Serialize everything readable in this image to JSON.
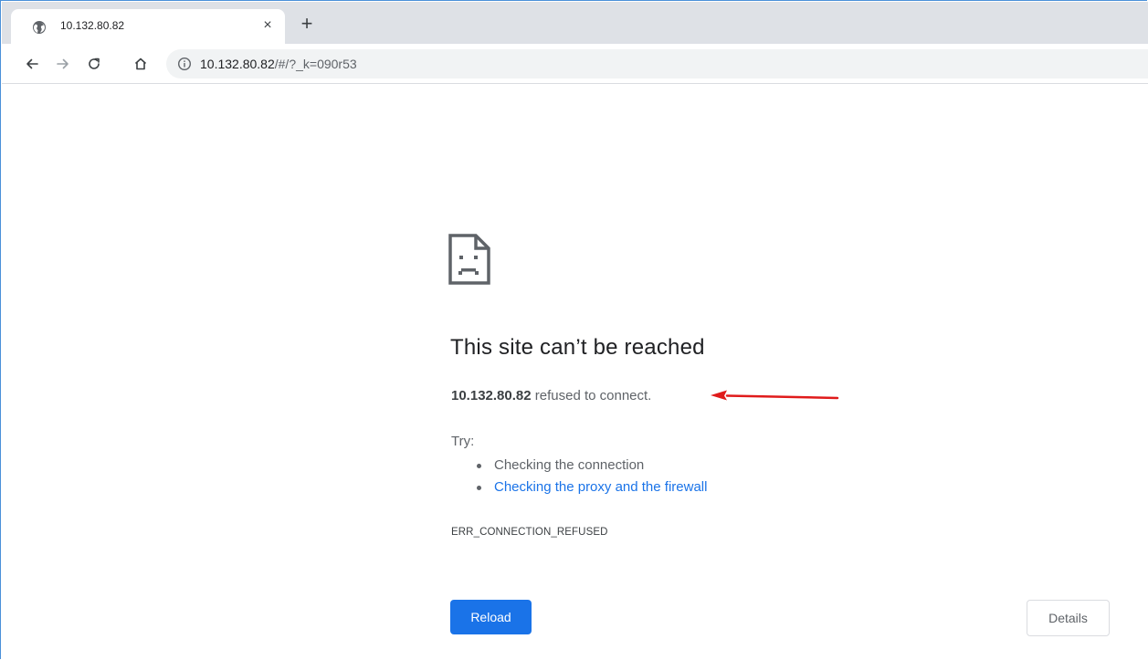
{
  "tab": {
    "title": "10.132.80.82",
    "close_label": "×",
    "new_tab_label": "+"
  },
  "toolbar": {
    "url_host": "10.132.80.82",
    "url_rest": "/#/?_k=090r53"
  },
  "error_page": {
    "heading": "This site can’t be reached",
    "host": "10.132.80.82",
    "summary_suffix": "refused to connect.",
    "try_label": "Try:",
    "suggestions": [
      {
        "text": "Checking the connection",
        "is_link": false
      },
      {
        "text": "Checking the proxy and the firewall",
        "is_link": true
      }
    ],
    "error_code": "ERR_CONNECTION_REFUSED",
    "reload_label": "Reload",
    "details_label": "Details"
  },
  "colors": {
    "accent": "#1a73e8",
    "annotation_arrow": "#e01b1b",
    "tabstrip_bg": "#dee1e6"
  },
  "icons": {
    "favicon": "globe-icon",
    "info": "info-icon",
    "error": "sad-page-icon"
  }
}
